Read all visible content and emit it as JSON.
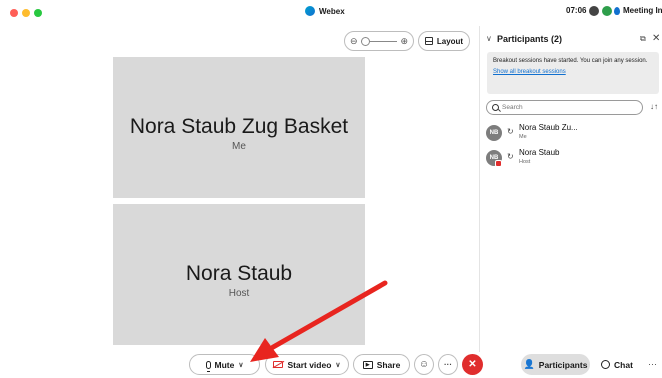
{
  "titlebar": {
    "app_title": "Webex",
    "time": "07:06",
    "meeting_info": "Meeting Info"
  },
  "video": {
    "layout_label": "Layout",
    "tiles": [
      {
        "name": "Nora Staub Zug Basket",
        "role": "Me"
      },
      {
        "name": "Nora Staub",
        "role": "Host"
      }
    ]
  },
  "panel": {
    "title": "Participants (2)",
    "notice_text": "Breakout sessions have started. You can join any session.",
    "notice_link": "Show all breakout sessions",
    "search_placeholder": "Search",
    "participants": [
      {
        "initials": "NB",
        "name": "Nora Staub Zu...",
        "role": "Me"
      },
      {
        "initials": "NB",
        "name": "Nora Staub",
        "role": "Host"
      }
    ]
  },
  "toolbar": {
    "mute_label": "Mute",
    "video_label": "Start video",
    "share_label": "Share",
    "participants_label": "Participants",
    "chat_label": "Chat"
  },
  "colors": {
    "end_call": "#e02d2d",
    "link": "#1170cf",
    "annotation_arrow": "#e8251f"
  },
  "icons": [
    "webex-logo-icon",
    "zoom-out-icon",
    "zoom-in-icon",
    "layout-icon",
    "popout-icon",
    "close-icon",
    "search-icon",
    "sort-icon",
    "mic-icon",
    "video-off-icon",
    "share-icon",
    "reactions-icon",
    "more-icon",
    "end-call-icon",
    "participants-icon",
    "chat-icon"
  ]
}
